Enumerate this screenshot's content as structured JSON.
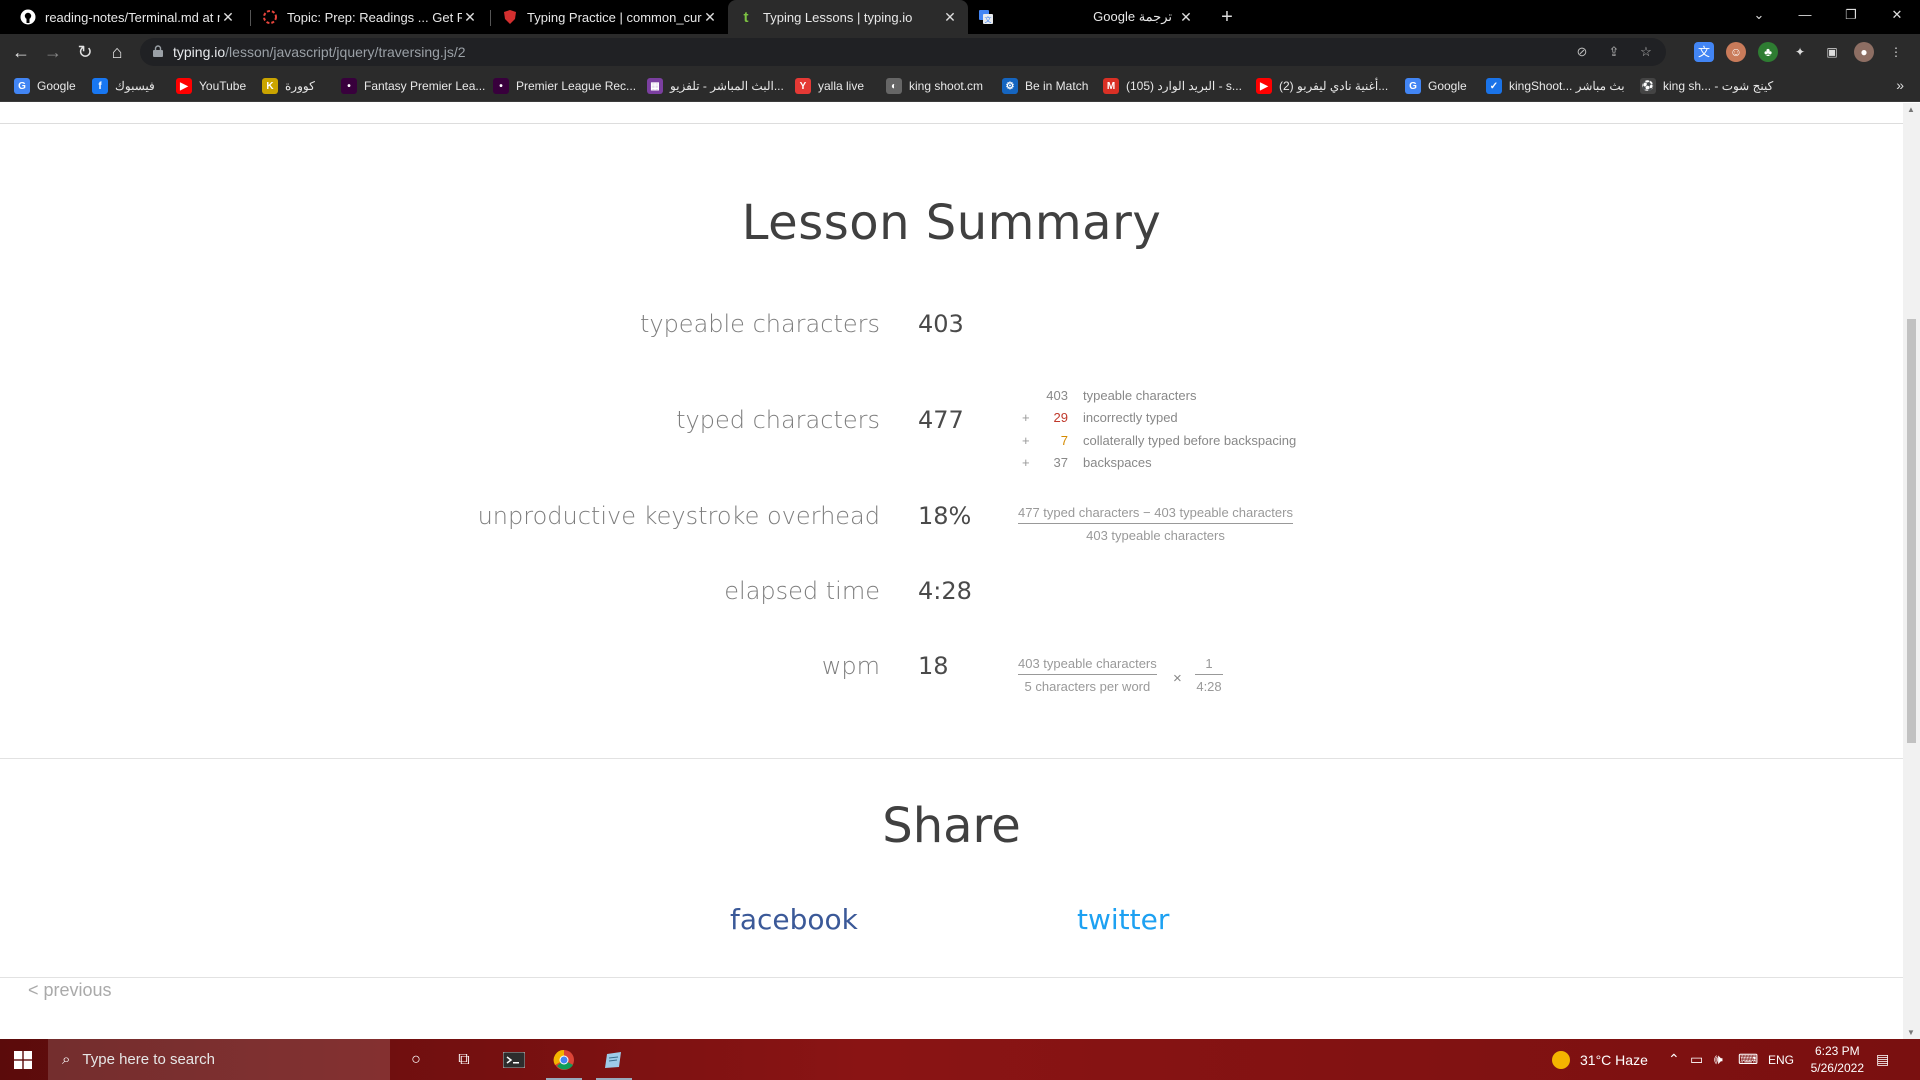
{
  "browser": {
    "tabs": [
      {
        "title": "reading-notes/Terminal.md at m",
        "icon": "github-icon"
      },
      {
        "title": "Topic: Prep: Readings ... Get Read",
        "icon": "loading-icon"
      },
      {
        "title": "Typing Practice | common_curric",
        "icon": "shield-icon"
      },
      {
        "title": "Typing Lessons | typing.io",
        "icon": "typing-io-icon"
      },
      {
        "title": "Google ترجمة",
        "icon": "google-translate-icon"
      }
    ],
    "url_host": "typing.io",
    "url_path": "/lesson/javascript/jquery/traversing.js/2"
  },
  "bookmarks": [
    {
      "label": "Google",
      "color": "#4285f4",
      "glyph": "G"
    },
    {
      "label": "فيسبوك",
      "color": "#1877f2",
      "glyph": "f"
    },
    {
      "label": "YouTube",
      "color": "#ff0000",
      "glyph": "▶"
    },
    {
      "label": "كوورة",
      "color": "#caa400",
      "glyph": "K"
    },
    {
      "label": "Fantasy Premier Lea...",
      "color": "#38003c",
      "glyph": "•"
    },
    {
      "label": "Premier League Rec...",
      "color": "#38003c",
      "glyph": "•"
    },
    {
      "label": "البث المباشر - تلفزيو...",
      "color": "#7b3fa0",
      "glyph": "▦"
    },
    {
      "label": "yalla live",
      "color": "#e53935",
      "glyph": "Y"
    },
    {
      "label": "king shoot.cm",
      "color": "#666666",
      "glyph": "◐"
    },
    {
      "label": "Be in Match",
      "color": "#1565c0",
      "glyph": "⚙"
    },
    {
      "label": "(105) البريد الوارد - s...",
      "color": "#d93025",
      "glyph": "M"
    },
    {
      "label": "(2) أغنية نادي ليفربو...",
      "color": "#ff0000",
      "glyph": "▶"
    },
    {
      "label": "Google",
      "color": "#4285f4",
      "glyph": "G"
    },
    {
      "label": "kingShoot... بث مباشر",
      "color": "#1a73e8",
      "glyph": "✓"
    },
    {
      "label": "king sh... - كينج شوت",
      "color": "#444444",
      "glyph": "⚽"
    }
  ],
  "lesson": {
    "title": "Lesson Summary",
    "stats": [
      {
        "label": "typeable characters",
        "value": "403"
      },
      {
        "label": "typed characters",
        "value": "477"
      },
      {
        "label": "unproductive keystroke overhead",
        "value": "18%"
      },
      {
        "label": "elapsed time",
        "value": "4:28"
      },
      {
        "label": "wpm",
        "value": "18"
      }
    ],
    "breakdown": [
      {
        "op": "",
        "num": "403",
        "desc": "typeable characters",
        "tone": "normal"
      },
      {
        "op": "+",
        "num": "29",
        "desc": "incorrectly typed",
        "tone": "red"
      },
      {
        "op": "+",
        "num": "7",
        "desc": "collaterally typed before backspacing",
        "tone": "orange"
      },
      {
        "op": "+",
        "num": "37",
        "desc": "backspaces",
        "tone": "normal"
      }
    ],
    "overhead_formula": {
      "numerator": "477 typed characters − 403 typeable characters",
      "denominator": "403 typeable characters"
    },
    "wpm_formula": {
      "left_numerator": "403 typeable characters",
      "left_denominator": "5 characters per word",
      "operator": "×",
      "right_numerator": "1",
      "right_denominator": "4:28"
    }
  },
  "share": {
    "title": "Share",
    "facebook": "facebook",
    "twitter": "twitter"
  },
  "nav": {
    "previous": "< previous"
  },
  "taskbar": {
    "search_placeholder": "Type here to search",
    "weather": "31°C  Haze",
    "language": "ENG",
    "time": "6:23 PM",
    "date": "5/26/2022"
  }
}
